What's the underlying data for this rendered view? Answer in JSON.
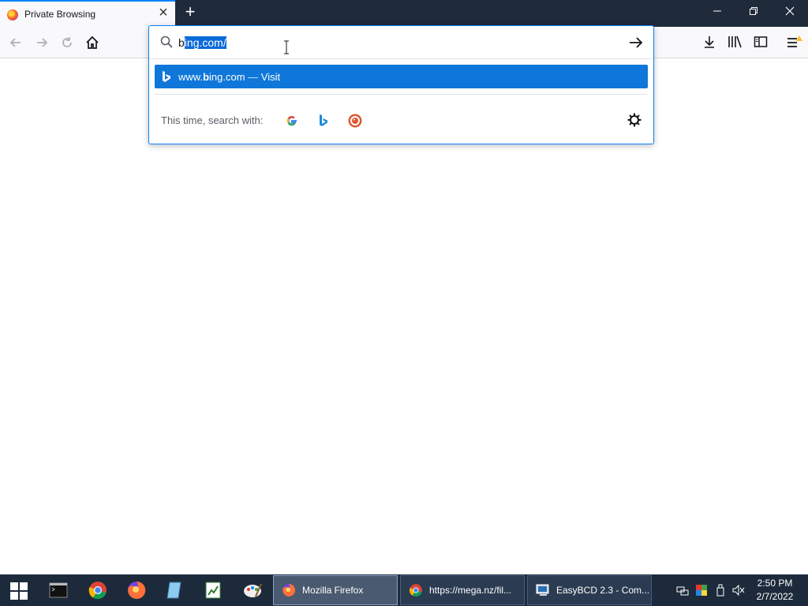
{
  "tab": {
    "title": "Private Browsing",
    "close_glyph": "×"
  },
  "new_tab_glyph": "+",
  "window_controls": {
    "minimize": "—",
    "restore": "❐",
    "close": "✕"
  },
  "nav": {
    "back": "←",
    "forward": "→",
    "reload": "↻",
    "home": "⌂"
  },
  "urlbar": {
    "typed": "b",
    "autofill_selected": "ing.com/"
  },
  "suggestion": {
    "host_prefix": "www.",
    "host_bold": "b",
    "host_rest": "ing.com",
    "separator": " — ",
    "action": "Visit"
  },
  "oneoff": {
    "label": "This time, search with:",
    "engines": [
      "google-icon",
      "bing-icon",
      "duckduckgo-icon"
    ]
  },
  "toolbar_icons": [
    "download-icon",
    "library-icon",
    "sidebar-icon",
    "menu-icon"
  ],
  "taskbar": {
    "tasks": [
      {
        "label": "Mozilla Firefox"
      },
      {
        "label": "https://mega.nz/fil..."
      },
      {
        "label": "EasyBCD 2.3 - Com..."
      }
    ],
    "clock_time": "2:50 PM",
    "clock_date": "2/7/2022"
  },
  "colors": {
    "accent": "#0a84ff",
    "selection": "#0f77d9",
    "titlebar": "#1f2a3a",
    "taskbar": "#1c2a3b"
  }
}
